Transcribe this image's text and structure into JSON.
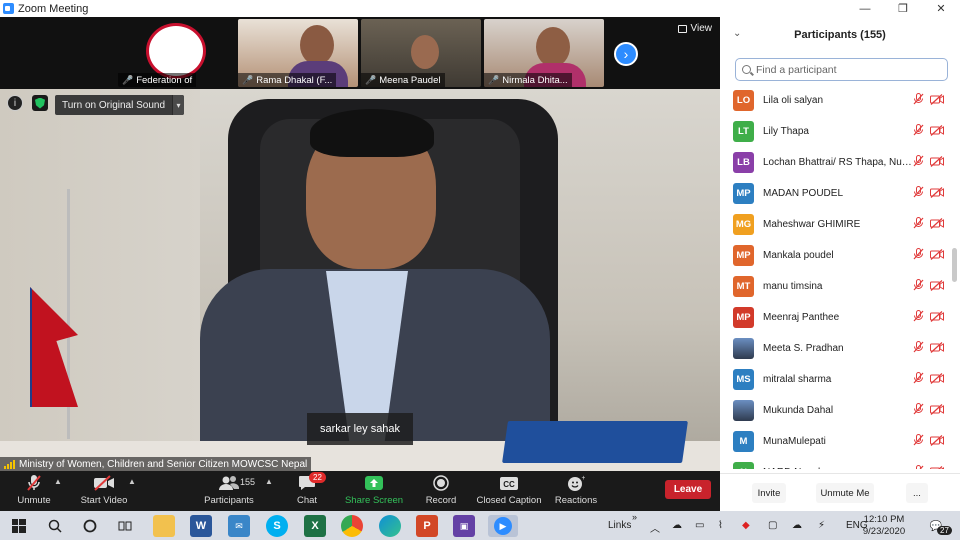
{
  "window": {
    "title": "Zoom Meeting",
    "minimize": "—",
    "maximize": "❐",
    "close": "✕"
  },
  "thumbnails": [
    {
      "name": "Federation of",
      "bg": "#ffffff"
    },
    {
      "name": "Rama Dhakal (F...",
      "bg": "#a07a63"
    },
    {
      "name": "Meena Paudel",
      "bg": "#7b6a55"
    },
    {
      "name": "Nirmala Dhita...",
      "bg": "#b38a70"
    }
  ],
  "view_label": "View",
  "original_sound": "Turn on Original Sound",
  "caption_text": "sarkar ley sahak",
  "speaker_name": "Ministry of Women, Children and Senior Citizen MOWCSC Nepal",
  "toolbar": {
    "unmute": "Unmute",
    "start_video": "Start Video",
    "participants": "Participants",
    "participants_count": "155",
    "chat": "Chat",
    "chat_badge": "22",
    "share_screen": "Share Screen",
    "record": "Record",
    "closed_caption": "Closed Caption",
    "reactions": "Reactions",
    "leave": "Leave"
  },
  "panel": {
    "title": "Participants (155)",
    "search_placeholder": "Find a participant",
    "participants": [
      {
        "initials": "LO",
        "name": "Lila oli salyan",
        "color": "#e0662c"
      },
      {
        "initials": "LT",
        "name": "Lily Thapa",
        "color": "#3fae49"
      },
      {
        "initials": "LB",
        "name": "Lochan Bhattrai/ RS Thapa, Nuw...",
        "color": "#8a3fa8"
      },
      {
        "initials": "MP",
        "name": "MADAN POUDEL",
        "color": "#2d7fc1"
      },
      {
        "initials": "MG",
        "name": "Maheshwar GHIMIRE",
        "color": "#f0a020"
      },
      {
        "initials": "MP",
        "name": "Mankala poudel",
        "color": "#e0662c"
      },
      {
        "initials": "MT",
        "name": "manu timsina",
        "color": "#e0662c"
      },
      {
        "initials": "MP",
        "name": "Meenraj Panthee",
        "color": "#d23a2a"
      },
      {
        "initials": "",
        "name": "Meeta S. Pradhan",
        "color": "#4a6d99"
      },
      {
        "initials": "MS",
        "name": "mitralal sharma",
        "color": "#2d7fc1"
      },
      {
        "initials": "",
        "name": "Mukunda Dahal",
        "color": "#6b5a4a"
      },
      {
        "initials": "M",
        "name": "MunaMulepati",
        "color": "#2d7fc1"
      },
      {
        "initials": "N",
        "name": "NARD Nepal",
        "color": "#3fae49"
      }
    ],
    "invite": "Invite",
    "mute_me": "Unmute Me",
    "more": "..."
  },
  "taskbar": {
    "links": "Links",
    "lang": "ENG",
    "time": "12:10 PM",
    "date": "9/23/2020",
    "notif_count": "27"
  }
}
